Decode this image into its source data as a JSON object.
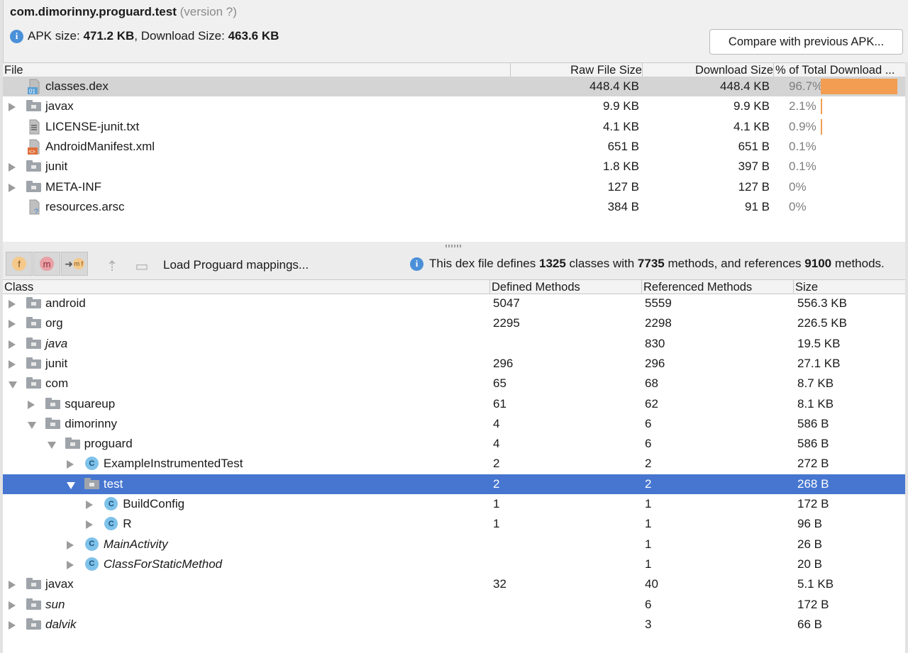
{
  "header": {
    "package_name": "com.dimorinny.proguard.test",
    "version_label": "(version ?)",
    "apk_size_label": "APK size:",
    "apk_size_value": "471.2 KB",
    "download_size_label": ", Download Size:",
    "download_size_value": "463.6 KB",
    "compare_button": "Compare with previous APK..."
  },
  "files_table": {
    "columns": [
      "File",
      "Raw File Size",
      "Download Size",
      "% of Total Download ..."
    ],
    "rows": [
      {
        "name": "classes.dex",
        "icon": "dex-file-icon",
        "expandable": false,
        "raw": "448.4 KB",
        "download": "448.4 KB",
        "pct": "96.7%",
        "pct_value": 96.7,
        "selected": true
      },
      {
        "name": "javax",
        "icon": "folder-icon",
        "expandable": true,
        "raw": "9.9 KB",
        "download": "9.9 KB",
        "pct": "2.1%",
        "pct_value": 2.1
      },
      {
        "name": "LICENSE-junit.txt",
        "icon": "text-file-icon",
        "expandable": false,
        "raw": "4.1 KB",
        "download": "4.1 KB",
        "pct": "0.9%",
        "pct_value": 0.9
      },
      {
        "name": "AndroidManifest.xml",
        "icon": "xml-file-icon",
        "expandable": false,
        "raw": "651 B",
        "download": "651 B",
        "pct": "0.1%",
        "pct_value": 0.1
      },
      {
        "name": "junit",
        "icon": "folder-icon",
        "expandable": true,
        "raw": "1.8 KB",
        "download": "397 B",
        "pct": "0.1%",
        "pct_value": 0.1
      },
      {
        "name": "META-INF",
        "icon": "folder-icon",
        "expandable": true,
        "raw": "127 B",
        "download": "127 B",
        "pct": "0%",
        "pct_value": 0
      },
      {
        "name": "resources.arsc",
        "icon": "unknown-file-icon",
        "expandable": false,
        "raw": "384 B",
        "download": "91 B",
        "pct": "0%",
        "pct_value": 0
      }
    ]
  },
  "toolbar": {
    "buttons": [
      "f",
      "m",
      "m f"
    ],
    "load_mappings": "Load Proguard mappings...",
    "dex_info_prefix": "This dex file defines",
    "dex_classes": "1325",
    "dex_mid1": "classes with",
    "dex_methods": "7735",
    "dex_mid2": "methods, and references",
    "dex_refs": "9100",
    "dex_suffix": "methods."
  },
  "class_table": {
    "columns": [
      "Class",
      "Defined Methods",
      "Referenced Methods",
      "Size"
    ],
    "rows": [
      {
        "name": "android",
        "depth": 0,
        "kind": "package",
        "state": "collapsed",
        "defined": "5047",
        "referenced": "5559",
        "size": "556.3 KB"
      },
      {
        "name": "org",
        "depth": 0,
        "kind": "package",
        "state": "collapsed",
        "defined": "2295",
        "referenced": "2298",
        "size": "226.5 KB"
      },
      {
        "name": "java",
        "depth": 0,
        "kind": "package",
        "state": "collapsed",
        "italic": true,
        "defined": "",
        "referenced": "830",
        "size": "19.5 KB"
      },
      {
        "name": "junit",
        "depth": 0,
        "kind": "package",
        "state": "collapsed",
        "defined": "296",
        "referenced": "296",
        "size": "27.1 KB"
      },
      {
        "name": "com",
        "depth": 0,
        "kind": "package",
        "state": "expanded",
        "defined": "65",
        "referenced": "68",
        "size": "8.7 KB"
      },
      {
        "name": "squareup",
        "depth": 1,
        "kind": "package",
        "state": "collapsed",
        "defined": "61",
        "referenced": "62",
        "size": "8.1 KB"
      },
      {
        "name": "dimorinny",
        "depth": 1,
        "kind": "package",
        "state": "expanded",
        "defined": "4",
        "referenced": "6",
        "size": "586 B"
      },
      {
        "name": "proguard",
        "depth": 2,
        "kind": "package",
        "state": "expanded",
        "defined": "4",
        "referenced": "6",
        "size": "586 B"
      },
      {
        "name": "ExampleInstrumentedTest",
        "depth": 3,
        "kind": "class",
        "state": "collapsed",
        "defined": "2",
        "referenced": "2",
        "size": "272 B"
      },
      {
        "name": "test",
        "depth": 3,
        "kind": "package",
        "state": "expanded",
        "selected": true,
        "defined": "2",
        "referenced": "2",
        "size": "268 B"
      },
      {
        "name": "BuildConfig",
        "depth": 4,
        "kind": "class",
        "state": "collapsed",
        "defined": "1",
        "referenced": "1",
        "size": "172 B"
      },
      {
        "name": "R",
        "depth": 4,
        "kind": "class",
        "state": "collapsed",
        "defined": "1",
        "referenced": "1",
        "size": "96 B"
      },
      {
        "name": "MainActivity",
        "depth": 3,
        "kind": "class",
        "state": "collapsed",
        "italic": true,
        "defined": "",
        "referenced": "1",
        "size": "26 B"
      },
      {
        "name": "ClassForStaticMethod",
        "depth": 3,
        "kind": "class",
        "state": "collapsed",
        "italic": true,
        "defined": "",
        "referenced": "1",
        "size": "20 B"
      },
      {
        "name": "javax",
        "depth": 0,
        "kind": "package",
        "state": "collapsed",
        "defined": "32",
        "referenced": "40",
        "size": "5.1 KB"
      },
      {
        "name": "sun",
        "depth": 0,
        "kind": "package",
        "state": "collapsed",
        "italic": true,
        "defined": "",
        "referenced": "6",
        "size": "172 B"
      },
      {
        "name": "dalvik",
        "depth": 0,
        "kind": "package",
        "state": "collapsed",
        "italic": true,
        "defined": "",
        "referenced": "3",
        "size": "66 B"
      }
    ]
  },
  "colors": {
    "selection_blue": "#4676d0",
    "selection_gray": "#d4d4d4",
    "bar_orange": "#f29d52",
    "class_icon": "#7ec2ea",
    "info_blue": "#4a90d9"
  }
}
